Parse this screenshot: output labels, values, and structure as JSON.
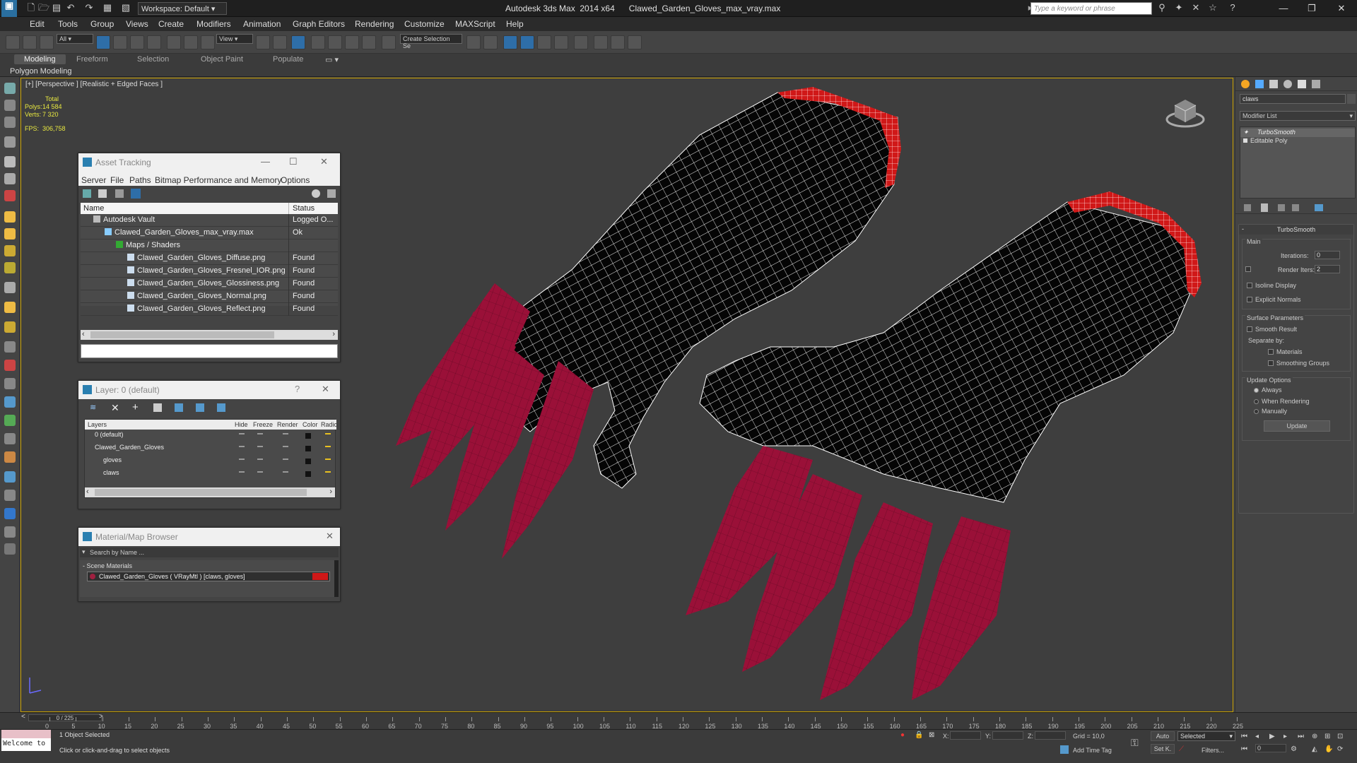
{
  "titlebar": {
    "app": "Autodesk 3ds Max  2014 x64",
    "file": "Clawed_Garden_Gloves_max_vray.max",
    "workspace": "Workspace: Default",
    "search_placeholder": "Type a keyword or phrase"
  },
  "menubar": [
    "Edit",
    "Tools",
    "Group",
    "Views",
    "Create",
    "Modifiers",
    "Animation",
    "Graph Editors",
    "Rendering",
    "Customize",
    "MAXScript",
    "Help"
  ],
  "toolbar": {
    "filter": "All",
    "view": "View",
    "named_selection": "Create Selection Se"
  },
  "ribbon": {
    "tabs": [
      "Modeling",
      "Freeform",
      "Selection",
      "Object Paint",
      "Populate"
    ],
    "active": "Modeling",
    "sub": "Polygon Modeling"
  },
  "viewport": {
    "label": "[+] [Perspective ] [Realistic + Edged Faces ]",
    "stats_total": "Total",
    "polys_label": "Polys:",
    "polys": "14 584",
    "verts_label": "Verts:",
    "verts": "7 320",
    "fps_label": "FPS:",
    "fps": "306,758"
  },
  "asset_tracking": {
    "title": "Asset Tracking",
    "menus": [
      "Server",
      "File",
      "Paths",
      "Bitmap Performance and Memory",
      "Options"
    ],
    "col_name": "Name",
    "col_status": "Status",
    "rows": [
      {
        "name": "Autodesk Vault",
        "status": "Logged O...",
        "indent": 0
      },
      {
        "name": "Clawed_Garden_Gloves_max_vray.max",
        "status": "Ok",
        "indent": 1
      },
      {
        "name": "Maps / Shaders",
        "status": "",
        "indent": 2
      },
      {
        "name": "Clawed_Garden_Gloves_Diffuse.png",
        "status": "Found",
        "indent": 3
      },
      {
        "name": "Clawed_Garden_Gloves_Fresnel_IOR.png",
        "status": "Found",
        "indent": 3
      },
      {
        "name": "Clawed_Garden_Gloves_Glossiness.png",
        "status": "Found",
        "indent": 3
      },
      {
        "name": "Clawed_Garden_Gloves_Normal.png",
        "status": "Found",
        "indent": 3
      },
      {
        "name": "Clawed_Garden_Gloves_Reflect.png",
        "status": "Found",
        "indent": 3
      }
    ]
  },
  "layer": {
    "title": "Layer: 0 (default)",
    "help": "?",
    "cols": [
      "Layers",
      "Hide",
      "Freeze",
      "Render",
      "Color",
      "Radio"
    ],
    "rows": [
      {
        "name": "0 (default)",
        "indent": 0
      },
      {
        "name": "Clawed_Garden_Gloves",
        "indent": 0
      },
      {
        "name": "gloves",
        "indent": 1
      },
      {
        "name": "claws",
        "indent": 1
      }
    ]
  },
  "material_browser": {
    "title": "Material/Map Browser",
    "search_placeholder": "Search by Name ...",
    "section": "- Scene Materials",
    "item": "Clawed_Garden_Gloves ( VRayMtl ) [claws, gloves]"
  },
  "command_panel": {
    "object_name": "claws",
    "modifier_list": "Modifier List",
    "stack": [
      "TurboSmooth",
      "Editable Poly"
    ],
    "turbosmooth_title": "TurboSmooth",
    "main": "Main",
    "iterations_label": "Iterations:",
    "iterations": "0",
    "render_iters_label": "Render Iters:",
    "render_iters": "2",
    "isoline": "Isoline Display",
    "explicit": "Explicit Normals",
    "surface": "Surface Parameters",
    "smooth_result": "Smooth Result",
    "separate_by": "Separate by:",
    "materials": "Materials",
    "smoothing_groups": "Smoothing Groups",
    "update_options": "Update Options",
    "always": "Always",
    "when_rendering": "When Rendering",
    "manually": "Manually",
    "update": "Update"
  },
  "timeline": {
    "frame": "0 / 225",
    "ticks": [
      0,
      5,
      10,
      15,
      20,
      25,
      30,
      35,
      40,
      45,
      50,
      55,
      60,
      65,
      70,
      75,
      80,
      85,
      90,
      95,
      100,
      105,
      110,
      115,
      120,
      125,
      130,
      135,
      140,
      145,
      150,
      155,
      160,
      165,
      170,
      175,
      180,
      185,
      190,
      195,
      200,
      205,
      210,
      215,
      220,
      225
    ]
  },
  "status": {
    "welcome": "Welcome to",
    "selected": "1 Object Selected",
    "hint": "Click or click-and-drag to select objects",
    "x_label": "X:",
    "y_label": "Y:",
    "z_label": "Z:",
    "grid": "Grid = 10,0",
    "add_time_tag": "Add Time Tag",
    "auto": "Auto",
    "setk": "Set K.",
    "selected_dd": "Selected",
    "filters": "Filters...",
    "frame_field": "0"
  },
  "colors": {
    "accent": "#2e6ea8",
    "claw": "#9a1038",
    "cuff": "#d01818",
    "viewport_border": "#c8a000"
  }
}
